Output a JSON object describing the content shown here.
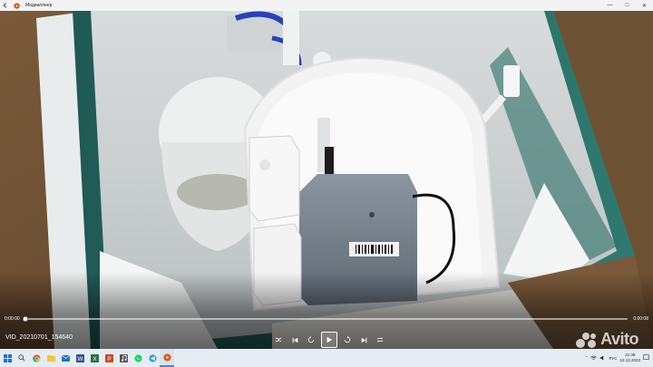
{
  "window": {
    "title": "Медиаплеер",
    "app_icon": "media-player-icon",
    "controls": [
      "minimize-icon",
      "maximize-icon",
      "close-icon"
    ]
  },
  "player": {
    "time_current": "0:00:00",
    "time_total": "0:00:08",
    "progress": 0.0,
    "file_name": "VID_20210701_154640",
    "buttons": [
      "shuffle-icon",
      "previous-icon",
      "rewind-10-icon",
      "play-icon",
      "forward-30-icon",
      "next-icon",
      "repeat-icon"
    ],
    "accent": "#e8e8e8"
  },
  "watermark": {
    "text": "Avito",
    "icon": "avito-logo-icon"
  },
  "taskbar": {
    "icons": [
      "windows-start-icon",
      "search-icon",
      "chrome-icon",
      "file-explorer-icon",
      "mail-icon",
      "word-icon",
      "excel-icon",
      "powerpoint-icon",
      "music-icon",
      "whatsapp-icon",
      "telegram-icon",
      "media-player-icon"
    ],
    "language": "РУС",
    "time": "21:36",
    "date": "12.12.2023"
  }
}
